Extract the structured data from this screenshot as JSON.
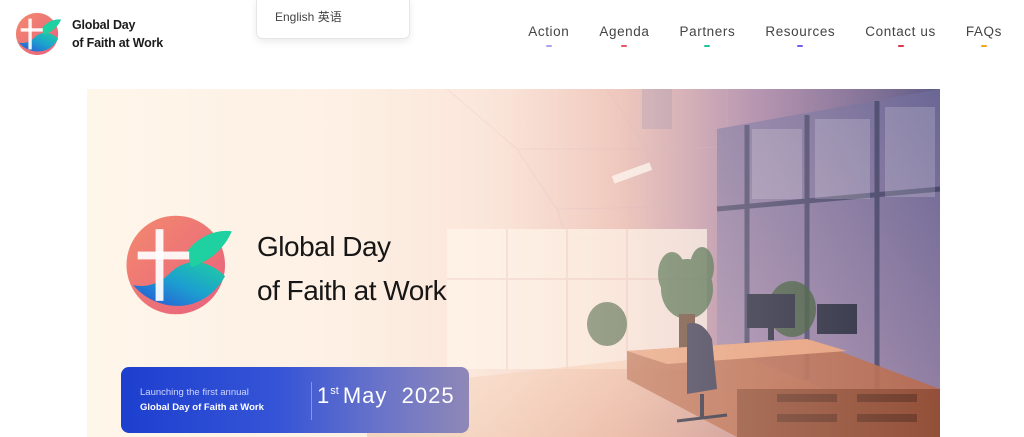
{
  "site": {
    "name_line1": "Global Day",
    "name_line2": "of Faith at Work"
  },
  "language": {
    "current": "English 英语"
  },
  "nav": {
    "items": [
      {
        "label": "Action",
        "color": "#a9a4f0"
      },
      {
        "label": "Agenda",
        "color": "#e8556a"
      },
      {
        "label": "Partners",
        "color": "#22c3a0"
      },
      {
        "label": "Resources",
        "color": "#7b5cf0"
      },
      {
        "label": "Contact us",
        "color": "#e0354a"
      },
      {
        "label": "FAQs",
        "color": "#f0a820"
      }
    ]
  },
  "hero": {
    "title_line1": "Global Day",
    "title_line2": "of Faith at Work",
    "launch_sub": "Launching the first annual",
    "launch_name": "Global Day of Faith at Work",
    "date_day": "1",
    "date_suffix": "st",
    "date_month": "May",
    "date_year": "2025"
  },
  "colors": {
    "brand_coral": "#ef7d78",
    "brand_blue": "#2a5bd7",
    "brand_teal": "#1fc7a8"
  }
}
